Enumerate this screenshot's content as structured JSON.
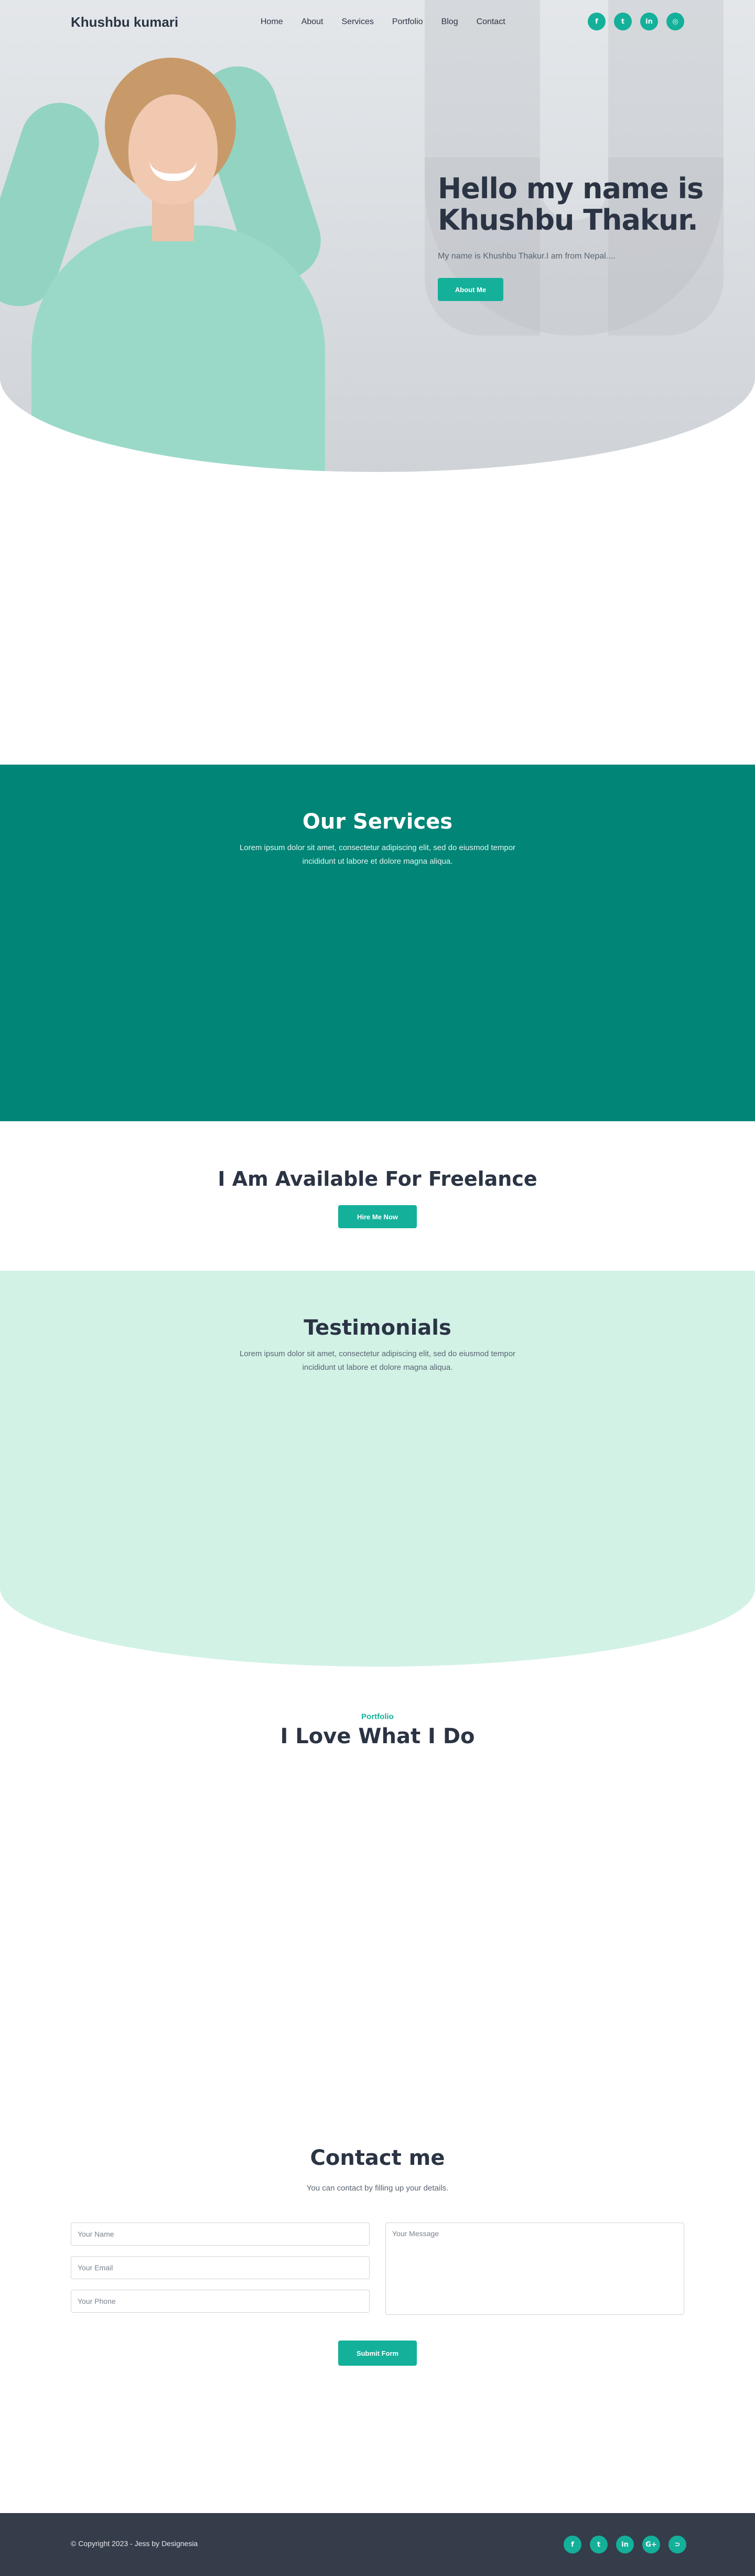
{
  "header": {
    "logo": "Khushbu kumari",
    "menu": [
      "Home",
      "About",
      "Services",
      "Portfolio",
      "Blog",
      "Contact"
    ],
    "social": [
      {
        "icon": "facebook-icon",
        "glyph": "f"
      },
      {
        "icon": "twitter-icon",
        "glyph": "t"
      },
      {
        "icon": "linkedin-icon",
        "glyph": "in"
      },
      {
        "icon": "instagram-icon",
        "glyph": "◎"
      }
    ]
  },
  "hero": {
    "heading_line1": "Hello my name is",
    "heading_line2": "Khushbu Thakur.",
    "subtitle": "My name is Khushbu Thakur.I am from Nepal....",
    "button": "About Me"
  },
  "services": {
    "title": "Our Services",
    "subtitle": "Lorem ipsum dolor sit amet, consectetur adipiscing elit, sed do eiusmod tempor incididunt ut labore et dolore magna aliqua."
  },
  "freelance": {
    "title": "I Am Available For Freelance",
    "button": "Hire Me Now"
  },
  "testimonials": {
    "title": "Testimonials",
    "subtitle": "Lorem ipsum dolor sit amet, consectetur adipiscing elit, sed do eiusmod tempor incididunt ut labore et dolore magna aliqua."
  },
  "portfolio": {
    "eyebrow": "Portfolio",
    "title": "I Love What I Do"
  },
  "contact": {
    "title": "Contact me",
    "subtitle": "You can contact by filling up your details.",
    "name_placeholder": "Your Name",
    "email_placeholder": "Your Email",
    "phone_placeholder": "Your Phone",
    "message_placeholder": "Your Message",
    "submit": "Submit Form"
  },
  "footer": {
    "copyright": "© Copyright 2023 - Jess by Designesia",
    "social": [
      {
        "icon": "facebook-icon",
        "glyph": "f"
      },
      {
        "icon": "twitter-icon",
        "glyph": "t"
      },
      {
        "icon": "linkedin-icon",
        "glyph": "in"
      },
      {
        "icon": "google-plus-icon",
        "glyph": "G+"
      },
      {
        "icon": "rss-icon",
        "glyph": "⊃"
      }
    ]
  },
  "colors": {
    "accent": "#14b09a",
    "services_bg": "#008576",
    "testimonials_bg": "#d2f2e6",
    "footer_bg": "#353c4a",
    "heading": "#2b3444"
  }
}
